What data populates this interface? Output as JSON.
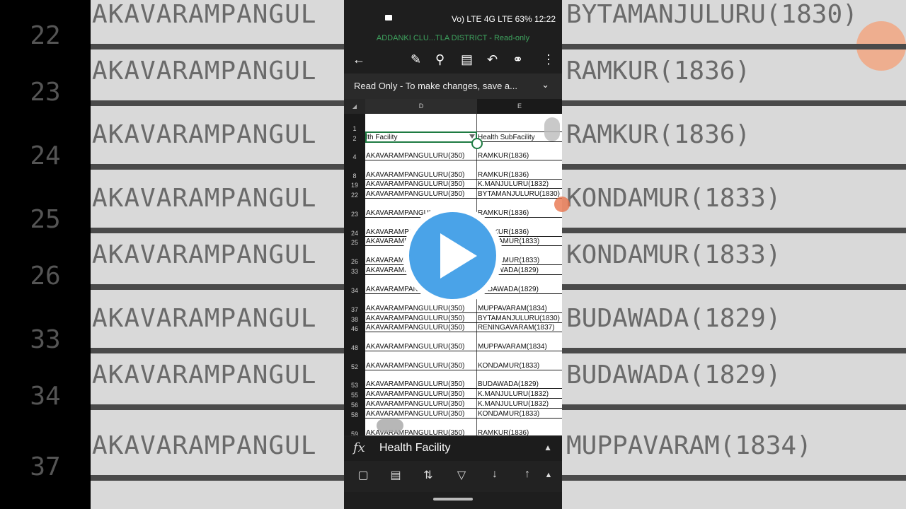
{
  "status": {
    "right_text": "Vo) LTE 4G LTE  63% 12:22",
    "battery": "63%",
    "time": "12:22"
  },
  "window_title": "ADDANKI  CLU...TLA DISTRICT - Read-only",
  "toolbar_icons": [
    "back-arrow-icon",
    "draw-icon",
    "search-icon",
    "save-icon",
    "undo-icon",
    "share-icon",
    "more-icon"
  ],
  "readonly_banner": "Read Only - To make changes, save a...",
  "columns": {
    "D": "D",
    "E": "E"
  },
  "rows": [
    {
      "n": "1",
      "d": "",
      "e": "",
      "h": 26
    },
    {
      "n": "2",
      "d": "lth Facility",
      "e": "Health SubFacility",
      "h": 14
    },
    {
      "n": "4",
      "d": "AKAVARAMPANGULURU(350)",
      "e": "RAMKUR(1836)",
      "h": 26
    },
    {
      "n": "8",
      "d": "AKAVARAMPANGULURU(350)",
      "e": "RAMKUR(1836)",
      "h": 27
    },
    {
      "n": "19",
      "d": "AKAVARAMPANGULURU(350)",
      "e": "K.MANJULURU(1832)",
      "h": 13
    },
    {
      "n": "22",
      "d": "AKAVARAMPANGULURU(350)",
      "e": "BYTAMANJULURU(1830)",
      "h": 14
    },
    {
      "n": "23",
      "d": "AKAVARAMPANGULURU(350)",
      "e": "RAMKUR(1836)",
      "h": 27
    },
    {
      "n": "24",
      "d": "AKAVARAMPANGULURU(350)",
      "e": "RAMKUR(1836)",
      "h": 27
    },
    {
      "n": "25",
      "d": "AKAVARAMPANGULURU(350)",
      "e": "KONDAMUR(1833)",
      "h": 13
    },
    {
      "n": "26",
      "d": "AKAVARAMPANGULURU(350)",
      "e": "KONDAMUR(1833)",
      "h": 27
    },
    {
      "n": "33",
      "d": "AKAVARAMPANGULURU(350)",
      "e": "BUDAWADA(1829)",
      "h": 14
    },
    {
      "n": "34",
      "d": "AKAVARAMPANGULURU(350)",
      "e": "BUDAWADA(1829)",
      "h": 27
    },
    {
      "n": "37",
      "d": "AKAVARAMPANGULURU(350)",
      "e": "MUPPAVARAM(1834)",
      "h": 27
    },
    {
      "n": "38",
      "d": "AKAVARAMPANGULURU(350)",
      "e": "BYTAMANJULURU(1830)",
      "h": 14
    },
    {
      "n": "46",
      "d": "AKAVARAMPANGULURU(350)",
      "e": "RENINGAVARAM(1837)",
      "h": 13
    },
    {
      "n": "48",
      "d": "AKAVARAMPANGULURU(350)",
      "e": "MUPPAVARAM(1834)",
      "h": 27
    },
    {
      "n": "52",
      "d": "AKAVARAMPANGULURU(350)",
      "e": "KONDAMUR(1833)",
      "h": 27
    },
    {
      "n": "53",
      "d": "AKAVARAMPANGULURU(350)",
      "e": "BUDAWADA(1829)",
      "h": 26
    },
    {
      "n": "55",
      "d": "AKAVARAMPANGULURU(350)",
      "e": "K.MANJULURU(1832)",
      "h": 14
    },
    {
      "n": "56",
      "d": "AKAVARAMPANGULURU(350)",
      "e": "K.MANJULURU(1832)",
      "h": 14
    },
    {
      "n": "58",
      "d": "AKAVARAMPANGULURU(350)",
      "e": "KONDAMUR(1833)",
      "h": 14
    },
    {
      "n": "59",
      "d": "AKAVARAMPANGULURU(350)",
      "e": "RAMKUR(1836)",
      "h": 27
    }
  ],
  "formula_bar": {
    "fx": "fx",
    "value": "Health Facility"
  },
  "bottom_icons": [
    "view-icon",
    "freeze-icon",
    "sort-column-icon",
    "filter-icon",
    "sort-ascending-icon",
    "sort-descending-icon",
    "expand-up-icon"
  ],
  "background": {
    "rows": [
      {
        "n": "22",
        "c1": "AKAVARAMPANGUL",
        "c2": "BYTAMANJULURU(1830)"
      },
      {
        "n": "23",
        "c1": "AKAVARAMPANGUL",
        "c2": "RAMKUR(1836)"
      },
      {
        "n": "24",
        "c1": "AKAVARAMPANGUL",
        "c2": "RAMKUR(1836)"
      },
      {
        "n": "25",
        "c1": "AKAVARAMPANGUL",
        "c2": "KONDAMUR(1833)"
      },
      {
        "n": "26",
        "c1": "AKAVARAMPANGUL",
        "c2": "KONDAMUR(1833)"
      },
      {
        "n": "33",
        "c1": "AKAVARAMPANGUL",
        "c2": "BUDAWADA(1829)"
      },
      {
        "n": "34",
        "c1": "AKAVARAMPANGUL",
        "c2": "BUDAWADA(1829)"
      },
      {
        "n": "37",
        "c1": "AKAVARAMPANGUL",
        "c2": "MUPPAVARAM(1834)"
      }
    ]
  },
  "accent": "#1e7b42",
  "play_color": "#4aa3e8"
}
